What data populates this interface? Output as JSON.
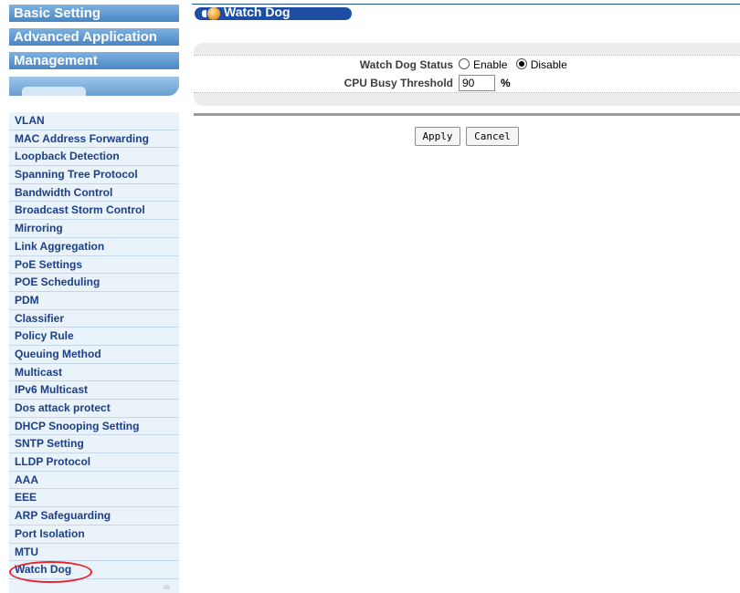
{
  "sidebar": {
    "top_menu": [
      "Basic Setting",
      "Advanced Application",
      "Management"
    ],
    "items": [
      "VLAN",
      "MAC Address Forwarding",
      "Loopback Detection",
      "Spanning Tree Protocol",
      "Bandwidth Control",
      "Broadcast Storm Control",
      "Mirroring",
      "Link Aggregation",
      "PoE Settings",
      "POE Scheduling",
      "PDM",
      "Classifier",
      "Policy Rule",
      "Queuing Method",
      "Multicast",
      "IPv6 Multicast",
      "Dos attack protect",
      "DHCP Snooping Setting",
      "SNTP Setting",
      "LLDP Protocol",
      "AAA",
      "EEE",
      "ARP Safeguarding",
      "Port Isolation",
      "MTU",
      "Watch Dog"
    ],
    "highlighted_item": "Watch Dog"
  },
  "main": {
    "title": "Watch Dog",
    "status_label": "Watch Dog Status",
    "enable_label": "Enable",
    "disable_label": "Disable",
    "status_value": "Disable",
    "cpu_label": "CPU Busy Threshold",
    "cpu_value": "90",
    "cpu_unit": "%",
    "apply_label": "Apply",
    "cancel_label": "Cancel"
  },
  "colors": {
    "menu_header": "#4a86c5",
    "menu_item_text": "#1b3f88",
    "title_bar": "#1e4ea3",
    "highlight_circle": "#e8222b"
  },
  "icons": {
    "title": "orange-orb-icon"
  }
}
